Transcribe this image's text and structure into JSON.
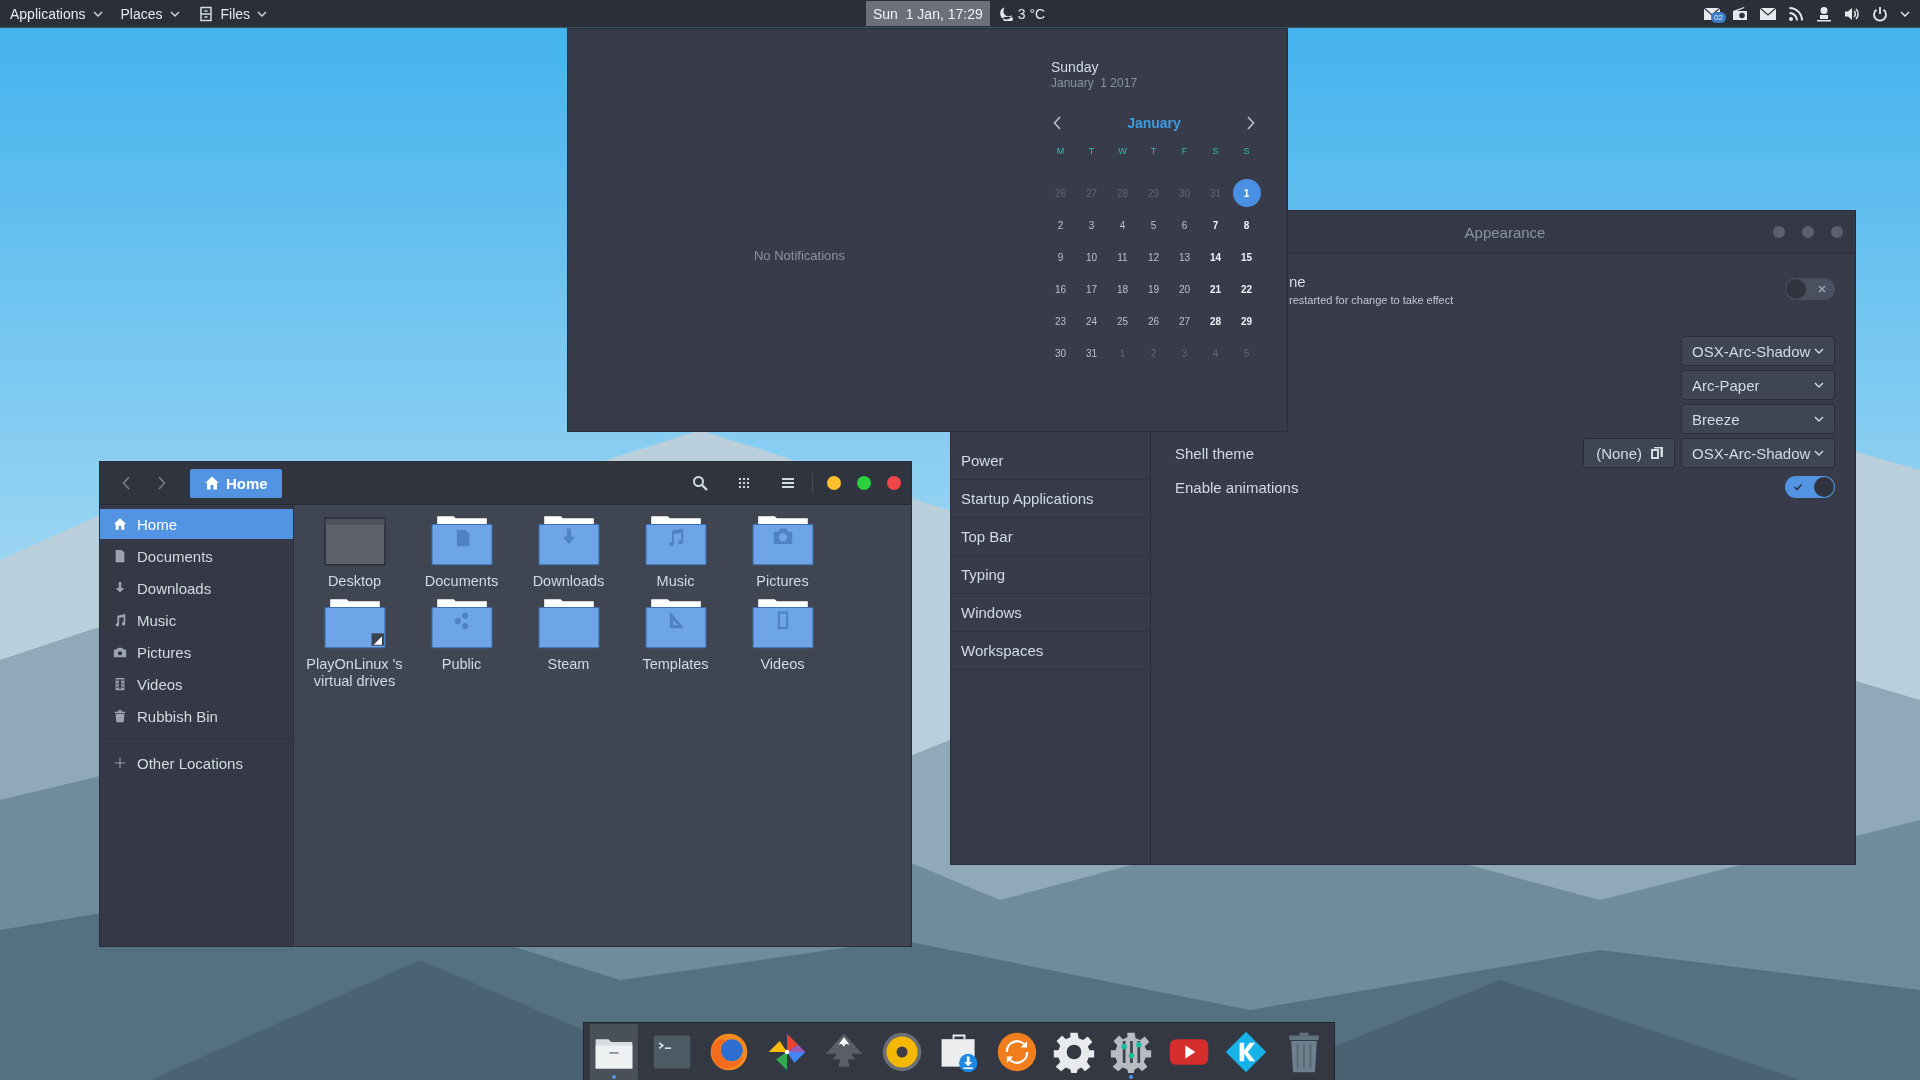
{
  "top_bar": {
    "menus": [
      {
        "label": "Applications"
      },
      {
        "label": "Places"
      },
      {
        "label": "Files"
      }
    ],
    "clock": "Sun  1 Jan, 17:29",
    "weather": "3 °C",
    "mail_badge": "02"
  },
  "calendar_popup": {
    "notifications": "No Notifications",
    "day_name": "Sunday",
    "date": "January  1 2017",
    "month": "January",
    "weekdays": [
      "M",
      "T",
      "W",
      "T",
      "F",
      "S",
      "S"
    ],
    "weeks": [
      [
        {
          "day": "26",
          "kind": "outside",
          "selected": false
        },
        {
          "day": "27",
          "kind": "outside",
          "selected": false
        },
        {
          "day": "28",
          "kind": "outside",
          "selected": false
        },
        {
          "day": "29",
          "kind": "outside",
          "selected": false
        },
        {
          "day": "30",
          "kind": "outside",
          "selected": false
        },
        {
          "day": "31",
          "kind": "outside",
          "selected": false
        },
        {
          "day": "1",
          "kind": "weekend",
          "selected": true
        }
      ],
      [
        {
          "day": "2",
          "kind": "weekday",
          "selected": false
        },
        {
          "day": "3",
          "kind": "weekday",
          "selected": false
        },
        {
          "day": "4",
          "kind": "weekday",
          "selected": false
        },
        {
          "day": "5",
          "kind": "weekday",
          "selected": false
        },
        {
          "day": "6",
          "kind": "weekday",
          "selected": false
        },
        {
          "day": "7",
          "kind": "weekend",
          "selected": false
        },
        {
          "day": "8",
          "kind": "weekend",
          "selected": false
        }
      ],
      [
        {
          "day": "9",
          "kind": "weekday",
          "selected": false
        },
        {
          "day": "10",
          "kind": "weekday",
          "selected": false
        },
        {
          "day": "11",
          "kind": "weekday",
          "selected": false
        },
        {
          "day": "12",
          "kind": "weekday",
          "selected": false
        },
        {
          "day": "13",
          "kind": "weekday",
          "selected": false
        },
        {
          "day": "14",
          "kind": "weekend",
          "selected": false
        },
        {
          "day": "15",
          "kind": "weekend",
          "selected": false
        }
      ],
      [
        {
          "day": "16",
          "kind": "weekday",
          "selected": false
        },
        {
          "day": "17",
          "kind": "weekday",
          "selected": false
        },
        {
          "day": "18",
          "kind": "weekday",
          "selected": false
        },
        {
          "day": "19",
          "kind": "weekday",
          "selected": false
        },
        {
          "day": "20",
          "kind": "weekday",
          "selected": false
        },
        {
          "day": "21",
          "kind": "weekend",
          "selected": false
        },
        {
          "day": "22",
          "kind": "weekend",
          "selected": false
        }
      ],
      [
        {
          "day": "23",
          "kind": "weekday",
          "selected": false
        },
        {
          "day": "24",
          "kind": "weekday",
          "selected": false
        },
        {
          "day": "25",
          "kind": "weekday",
          "selected": false
        },
        {
          "day": "26",
          "kind": "weekday",
          "selected": false
        },
        {
          "day": "27",
          "kind": "weekday",
          "selected": false
        },
        {
          "day": "28",
          "kind": "weekend",
          "selected": false
        },
        {
          "day": "29",
          "kind": "weekend",
          "selected": false
        }
      ],
      [
        {
          "day": "30",
          "kind": "weekday",
          "selected": false
        },
        {
          "day": "31",
          "kind": "weekday",
          "selected": false
        },
        {
          "day": "1",
          "kind": "outside",
          "selected": false
        },
        {
          "day": "2",
          "kind": "outside",
          "selected": false
        },
        {
          "day": "3",
          "kind": "outside",
          "selected": false
        },
        {
          "day": "4",
          "kind": "outside",
          "selected": false
        },
        {
          "day": "5",
          "kind": "outside",
          "selected": false
        }
      ]
    ]
  },
  "appearance_window": {
    "title": "Appearance",
    "sidebar": [
      {
        "label": "Power",
        "selected": false
      },
      {
        "label": "Startup Applications",
        "selected": false
      },
      {
        "label": "Top Bar",
        "selected": false
      },
      {
        "label": "Typing",
        "selected": false
      },
      {
        "label": "Windows",
        "selected": false
      },
      {
        "label": "Workspaces",
        "selected": false
      }
    ],
    "rows": [
      {
        "kind": "toggle",
        "label": "ne",
        "note": "restarted for change to take effect",
        "on": false
      },
      {
        "kind": "dropdown",
        "value": "OSX-Arc-Shadow"
      },
      {
        "kind": "dropdown",
        "value": "Arc-Paper"
      },
      {
        "kind": "dropdown",
        "value": "Breeze"
      },
      {
        "kind": "dropdown",
        "label": "Shell theme",
        "reset": "(None)",
        "value": "OSX-Arc-Shadow"
      },
      {
        "kind": "toggle",
        "label": "Enable animations",
        "on": true
      }
    ]
  },
  "files_window": {
    "location": "Home",
    "sidebar": [
      {
        "label": "Home",
        "selected": true
      },
      {
        "label": "Documents",
        "selected": false
      },
      {
        "label": "Downloads",
        "selected": false
      },
      {
        "label": "Music",
        "selected": false
      },
      {
        "label": "Pictures",
        "selected": false
      },
      {
        "label": "Videos",
        "selected": false
      },
      {
        "label": "Rubbish Bin",
        "selected": false
      },
      {
        "label": "Other Locations",
        "selected": false
      }
    ],
    "items": [
      {
        "name": "Desktop"
      },
      {
        "name": "Documents"
      },
      {
        "name": "Downloads"
      },
      {
        "name": "Music"
      },
      {
        "name": "Pictures"
      },
      {
        "name": "PlayOnLinux 's virtual drives"
      },
      {
        "name": "Public"
      },
      {
        "name": "Steam"
      },
      {
        "name": "Templates"
      },
      {
        "name": "Videos"
      }
    ]
  },
  "dock": [
    {
      "running": true
    },
    {
      "running": false
    },
    {
      "running": false
    },
    {
      "running": false
    },
    {
      "running": false
    },
    {
      "running": false
    },
    {
      "running": false
    },
    {
      "running": false
    },
    {
      "running": false
    },
    {
      "running": true
    },
    {
      "running": false
    },
    {
      "running": false
    },
    {
      "running": false
    }
  ]
}
